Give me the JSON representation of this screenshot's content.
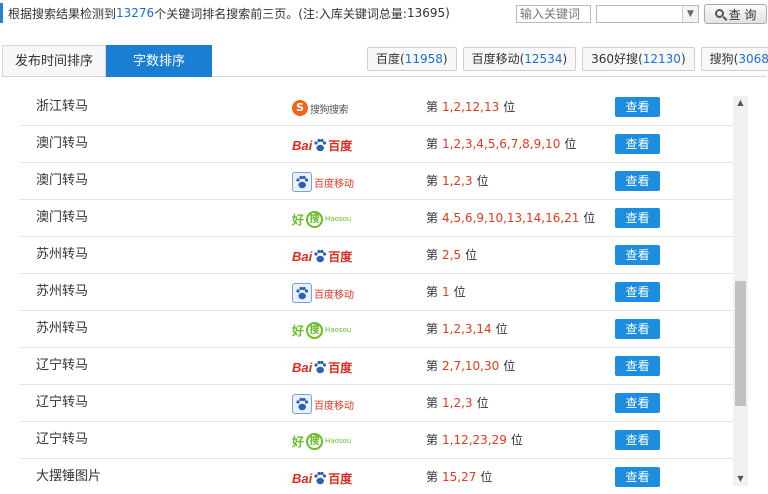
{
  "summary": {
    "prefix": "根据搜索结果检测到",
    "count": "13276",
    "mid": "个关键词排名搜索前三页。(注:入库关键词总量:",
    "total": "13695",
    "suffix": ")"
  },
  "search": {
    "placeholder": "输入关键词",
    "button_label": "查 询",
    "select_value": ""
  },
  "tabs": [
    {
      "label": "发布时间排序",
      "active": false
    },
    {
      "label": "字数排序",
      "active": true
    }
  ],
  "engines": [
    {
      "name": "百度",
      "count": "11958"
    },
    {
      "name": "百度移动",
      "count": "12534"
    },
    {
      "name": "360好搜",
      "count": "12130"
    },
    {
      "name": "搜狗",
      "count": "3068"
    }
  ],
  "logo_text": {
    "sogou_mark": "S",
    "sogou": "搜狗搜索",
    "baidu_a": "Bai",
    "baidu_b": "百度",
    "baidu_mobile": "百度移动",
    "haosou_a": "好",
    "haosou_b": "搜",
    "haosou_en": "Haosou"
  },
  "rank_prefix": "第",
  "rank_suffix": "位",
  "view_label": "查看",
  "rows": [
    {
      "keyword": "浙江转马",
      "engine": "sogou",
      "ranks": "1,2,12,13"
    },
    {
      "keyword": "澳门转马",
      "engine": "baidu",
      "ranks": "1,2,3,4,5,6,7,8,9,10"
    },
    {
      "keyword": "澳门转马",
      "engine": "baidu-mobile",
      "ranks": "1,2,3"
    },
    {
      "keyword": "澳门转马",
      "engine": "haosou",
      "ranks": "4,5,6,9,10,13,14,16,21"
    },
    {
      "keyword": "苏州转马",
      "engine": "baidu",
      "ranks": "2,5"
    },
    {
      "keyword": "苏州转马",
      "engine": "baidu-mobile",
      "ranks": "1"
    },
    {
      "keyword": "苏州转马",
      "engine": "haosou",
      "ranks": "1,2,3,14"
    },
    {
      "keyword": "辽宁转马",
      "engine": "baidu",
      "ranks": "2,7,10,30"
    },
    {
      "keyword": "辽宁转马",
      "engine": "baidu-mobile",
      "ranks": "1,2,3"
    },
    {
      "keyword": "辽宁转马",
      "engine": "haosou",
      "ranks": "1,12,23,29"
    },
    {
      "keyword": "大摆锤图片",
      "engine": "baidu",
      "ranks": "15,27"
    }
  ],
  "colors": {
    "accent": "#1a7fd4",
    "rank": "#e23a1a",
    "view_button": "#1d8de0"
  }
}
